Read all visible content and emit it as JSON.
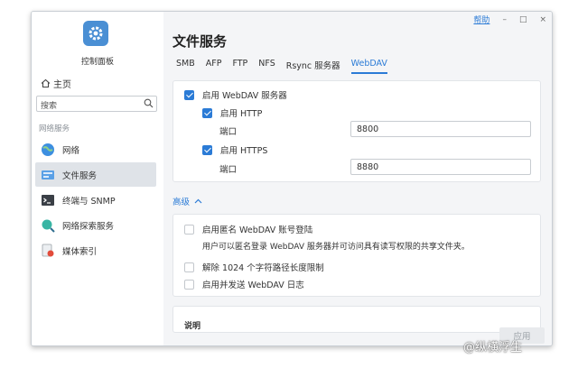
{
  "app": {
    "title": "控制面板"
  },
  "sidebar": {
    "home": "主页",
    "search_placeholder": "搜索",
    "group": "网络服务",
    "items": [
      {
        "label": "网络",
        "icon": "globe-icon"
      },
      {
        "label": "文件服务",
        "icon": "file-services-icon",
        "active": true
      },
      {
        "label": "终端与 SNMP",
        "icon": "terminal-icon"
      },
      {
        "label": "网络探索服务",
        "icon": "network-discovery-icon"
      },
      {
        "label": "媒体索引",
        "icon": "media-index-icon"
      }
    ]
  },
  "window_controls": {
    "help": "帮助",
    "minimize": "–",
    "maximize": "□",
    "close": "×"
  },
  "page": {
    "title": "文件服务",
    "tabs": [
      "SMB",
      "AFP",
      "FTP",
      "NFS",
      "Rsync 服务器",
      "WebDAV"
    ],
    "active_tab": "WebDAV"
  },
  "webdav": {
    "enable_label": "启用 WebDAV 服务器",
    "http_label": "启用 HTTP",
    "http_port_label": "端口",
    "http_port": "8800",
    "https_label": "启用 HTTPS",
    "https_port_label": "端口",
    "https_port": "8880"
  },
  "advanced": {
    "label": "高级",
    "anon_label": "启用匿名 WebDAV 账号登陆",
    "anon_desc": "用户可以匿名登录 WebDAV 服务器并可访问具有读写权限的共享文件夹。",
    "path_limit_label": "解除 1024 个字符路径长度限制",
    "log_label": "启用并发送 WebDAV 日志"
  },
  "footer": {
    "partial_card_title": "说明",
    "apply_label": "应用"
  },
  "watermark": "@纵横浮生"
}
